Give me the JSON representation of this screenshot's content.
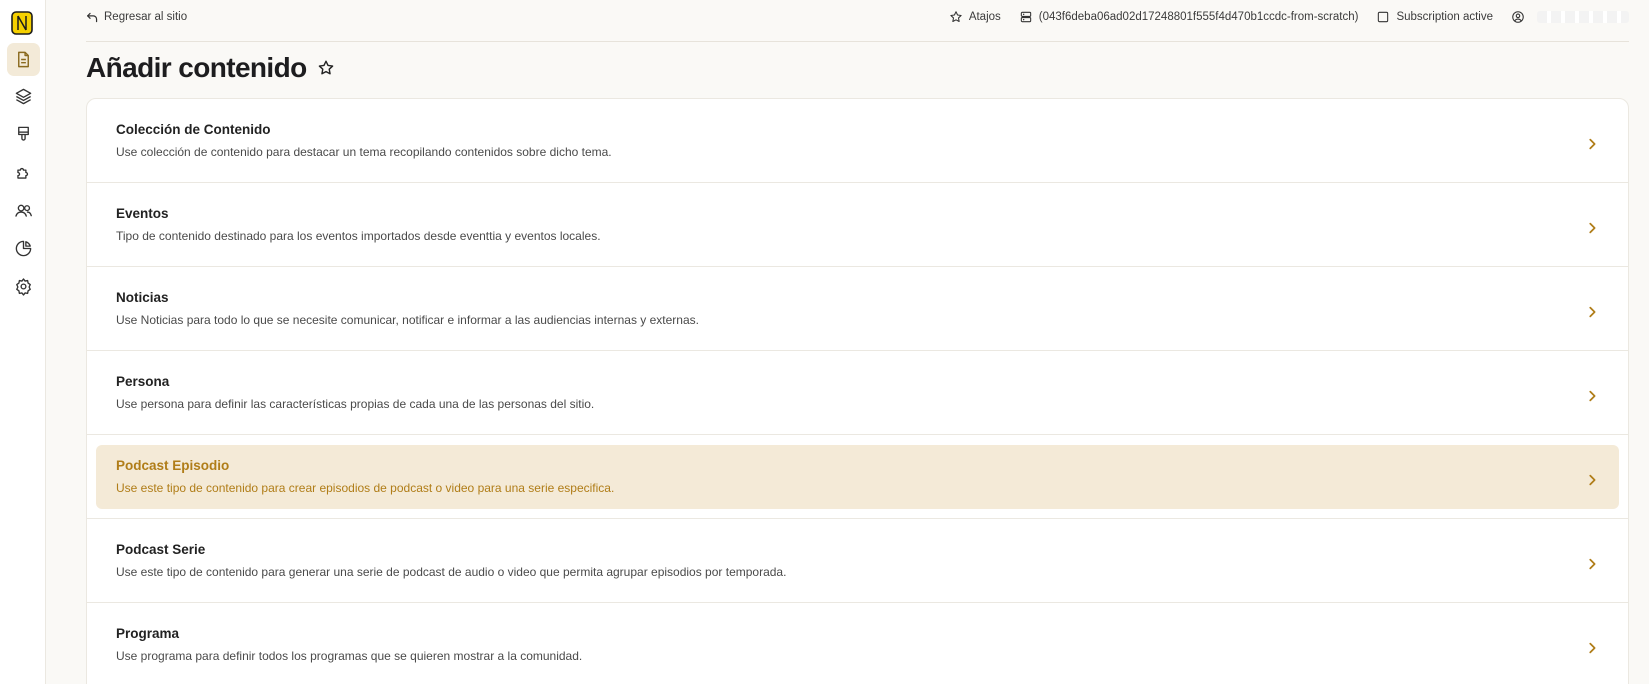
{
  "topbar": {
    "back_label": "Regresar al sitio",
    "shortcuts_label": "Atajos",
    "site_id": "(043f6deba06ad02d17248801f555f4d470b1ccdc-from-scratch)",
    "subscription_label": "Subscription active"
  },
  "page": {
    "title": "Añadir contenido"
  },
  "content_types": [
    {
      "title": "Colección de Contenido",
      "description": "Use colección de contenido para destacar un tema recopilando contenidos sobre dicho tema."
    },
    {
      "title": "Eventos",
      "description": "Tipo de contenido destinado para los eventos importados desde eventtia y eventos locales."
    },
    {
      "title": "Noticias",
      "description": "Use Noticias para todo lo que se necesite comunicar, notificar e informar a las audiencias internas y externas."
    },
    {
      "title": "Persona",
      "description": "Use persona para definir las características propias de cada una de las personas del sitio."
    },
    {
      "title": "Podcast Episodio",
      "description": "Use este tipo de contenido para crear episodios de podcast o video para una serie especifica."
    },
    {
      "title": "Podcast Serie",
      "description": "Use este tipo de contenido para generar una serie de podcast de audio o video que permita agrupar episodios por temporada."
    },
    {
      "title": "Programa",
      "description": "Use programa para definir todos los programas que se quieren mostrar a la comunidad."
    }
  ],
  "sidebar_icons": [
    "content-icon",
    "layers-icon",
    "brush-icon",
    "extensions-icon",
    "people-icon",
    "analytics-icon",
    "settings-icon"
  ],
  "colors": {
    "accent": "#b07d18",
    "highlight_bg": "#f4ead7",
    "logo_yellow": "#f5d000"
  }
}
